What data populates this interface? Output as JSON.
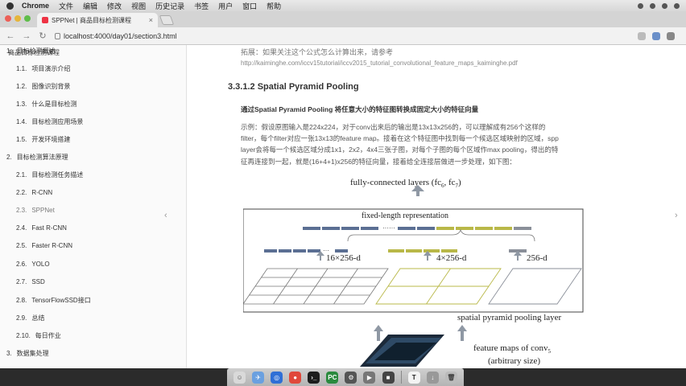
{
  "menubar": {
    "app": "Chrome",
    "items": [
      "文件",
      "编辑",
      "修改",
      "视图",
      "历史记录",
      "书签",
      "用户",
      "窗口",
      "帮助"
    ]
  },
  "tab": {
    "title": "SPPNet | 商品目标检测课程"
  },
  "address": {
    "url": "localhost:4000/day01/section3.html"
  },
  "sidebar": {
    "title": "商品目标检测课程",
    "items": [
      {
        "num": "1.",
        "label": "目标检测概述",
        "level": 0
      },
      {
        "num": "1.1.",
        "label": "项目演示介绍",
        "level": 1
      },
      {
        "num": "1.2.",
        "label": "图像识别背景",
        "level": 1
      },
      {
        "num": "1.3.",
        "label": "什么是目标检测",
        "level": 1
      },
      {
        "num": "1.4.",
        "label": "目标检测应用场景",
        "level": 1
      },
      {
        "num": "1.5.",
        "label": "开发环境搭建",
        "level": 1
      },
      {
        "num": "2.",
        "label": "目标检测算法原理",
        "level": 0
      },
      {
        "num": "2.1.",
        "label": "目标检测任务描述",
        "level": 1
      },
      {
        "num": "2.2.",
        "label": "R-CNN",
        "level": 1
      },
      {
        "num": "2.3.",
        "label": "SPPNet",
        "level": 1
      },
      {
        "num": "2.4.",
        "label": "Fast R-CNN",
        "level": 1
      },
      {
        "num": "2.5.",
        "label": "Faster R-CNN",
        "level": 1
      },
      {
        "num": "2.6.",
        "label": "YOLO",
        "level": 1
      },
      {
        "num": "2.7.",
        "label": "SSD",
        "level": 1
      },
      {
        "num": "2.8.",
        "label": "TensorFlowSSD接口",
        "level": 1
      },
      {
        "num": "2.9.",
        "label": "总结",
        "level": 1
      },
      {
        "num": "2.10.",
        "label": "每日作业",
        "level": 1
      },
      {
        "num": "3.",
        "label": "数据集处理",
        "level": 0
      }
    ]
  },
  "content": {
    "ref_text": "拓展：如果关注这个公式怎么计算出来，请参考",
    "ref_link": "http://kaiminghe.com/iccv15tutorial/iccv2015_tutorial_convolutional_feature_maps_kaiminghe.pdf",
    "heading": "3.3.1.2 Spatial Pyramid Pooling",
    "lead": "通过Spatial Pyramid Pooling 将任意大小的特征图转换成固定大小的特征向量",
    "para_lines": [
      "示例：假设原图输入是224x224，对于conv出来后的输出是13x13x256的，可以理解成有256个这样的",
      "filter，每个filter对应一张13x13的feature map。接着在这个特征图中找到每一个候选区域映射的区域，spp",
      "layer会将每一个候选区域分成1x1，2x2，4x4三张子图，对每个子图的每个区域作max pooling，得出的特",
      "征再连接到一起，就是(16+4+1)x256的特征向量，接着给全连接层做进一步处理，如下图："
    ]
  },
  "figure": {
    "top_label": "fully-connected layers (fc",
    "fc6": "6",
    "fc7": "7",
    "fixed_label": "fixed-length representation",
    "dim16": "16×256-d",
    "dim4": "4×256-d",
    "dim1": "256-d",
    "spp_label": "spatial pyramid pooling layer",
    "fm_label1": "feature maps of conv",
    "fm_sub": "5",
    "fm_label2": "(arbitrary size)"
  },
  "colors": {
    "accent_olive": "#b9b848",
    "bar_blue": "#5b6f93",
    "bar_gray": "#8a8f99",
    "arrow": "#8f98a4"
  }
}
